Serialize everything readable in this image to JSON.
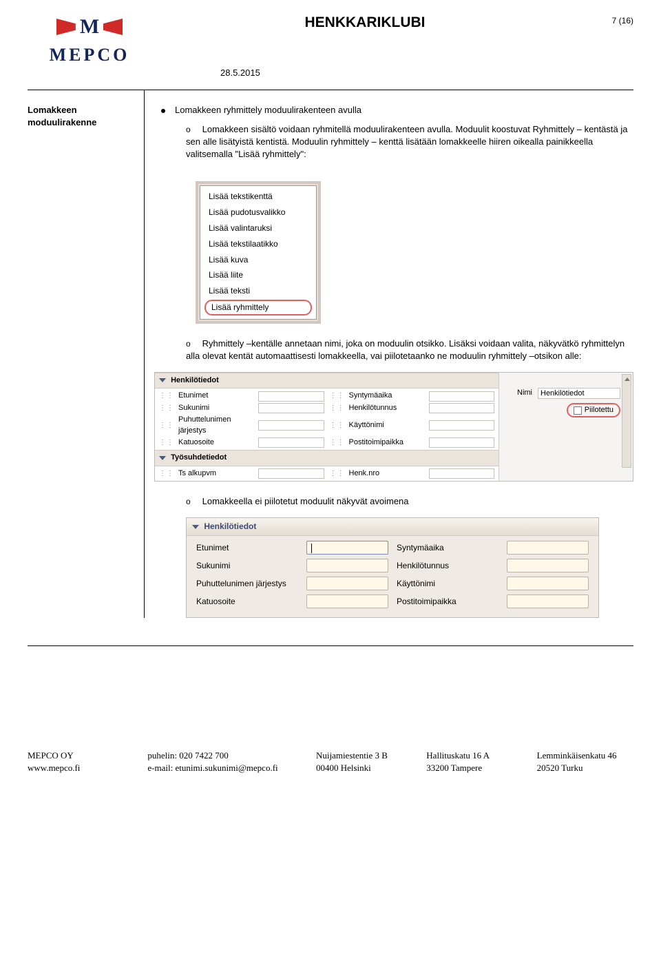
{
  "header": {
    "logo_brand": "MEPCO",
    "title": "HENKKARIKLUBI",
    "date": "28.5.2015",
    "page_number": "7 (16)"
  },
  "sidebar": {
    "heading_line1": "Lomakkeen",
    "heading_line2": "moduulirakenne"
  },
  "bullet": {
    "main": "Lomakkeen ryhmittely moduulirakenteen avulla"
  },
  "sub1": {
    "marker": "o",
    "text": "Lomakkeen sisältö voidaan ryhmitellä moduulirakenteen avulla. Moduulit koostuvat Ryhmittely – kentästä ja sen alle lisätyistä kentistä. Moduulin ryhmittely – kenttä lisätään lomakkeelle hiiren oikealla painikkeella valitsemalla \"Lisää ryhmittely\":"
  },
  "context_menu": {
    "items": [
      "Lisää tekstikenttä",
      "Lisää pudotusvalikko",
      "Lisää valintaruksi",
      "Lisää tekstilaatikko",
      "Lisää kuva",
      "Lisää liite",
      "Lisää teksti",
      "Lisää ryhmittely"
    ]
  },
  "sub2": {
    "marker": "o",
    "text": "Ryhmittely –kentälle annetaan nimi, joka on moduulin otsikko. Lisäksi voidaan valita, näkyvätkö ryhmittelyn alla olevat kentät automaattisesti lomakkeella, vai piilotetaanko ne moduulin ryhmittely –otsikon alle:"
  },
  "designer": {
    "group1": {
      "title": "Henkilötiedot"
    },
    "group1_rows": [
      [
        "Etunimet",
        "Syntymäaika"
      ],
      [
        "Sukunimi",
        "Henkilötunnus"
      ],
      [
        "Puhuttelunimen järjestys",
        "Käyttönimi"
      ],
      [
        "Katuosoite",
        "Postitoimipaikka"
      ]
    ],
    "group2": {
      "title": "Työsuhdetiedot"
    },
    "group2_rows": [
      [
        "Ts alkupvm",
        "Henk.nro"
      ]
    ],
    "props": {
      "nimi_label": "Nimi",
      "nimi_value": "Henkilötiedot",
      "piilotettu_label": "Piilotettu"
    }
  },
  "sub3": {
    "marker": "o",
    "text": "Lomakkeella ei piilotetut moduulit näkyvät avoimena"
  },
  "result_form": {
    "header": "Henkilötiedot",
    "rows": [
      [
        "Etunimet",
        "Syntymäaika"
      ],
      [
        "Sukunimi",
        "Henkilötunnus"
      ],
      [
        "Puhuttelunimen järjestys",
        "Käyttönimi"
      ],
      [
        "Katuosoite",
        "Postitoimipaikka"
      ]
    ]
  },
  "footer": {
    "c1a": "MEPCO OY",
    "c1b": "www.mepco.fi",
    "c2a": "puhelin: 020 7422 700",
    "c2b": "e-mail: etunimi.sukunimi@mepco.fi",
    "c3a": "Nuijamiestentie 3 B",
    "c3b": "00400 Helsinki",
    "c4a": "Hallituskatu 16 A",
    "c4b": "33200 Tampere",
    "c5a": "Lemminkäisenkatu 46",
    "c5b": "20520 Turku"
  }
}
